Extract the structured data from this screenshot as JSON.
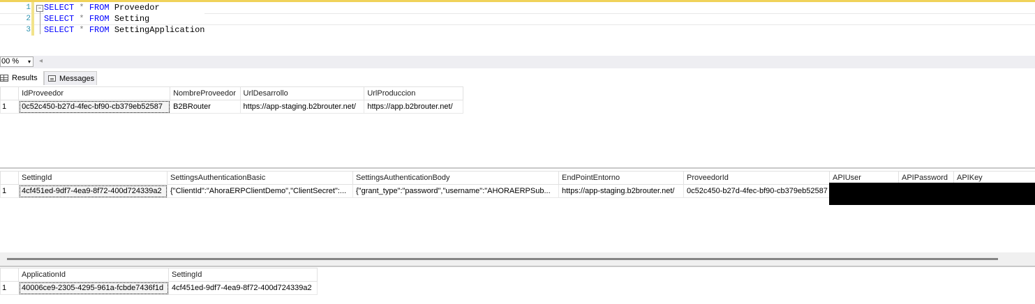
{
  "editor": {
    "line_numbers": [
      "1",
      "2",
      "3"
    ],
    "lines": [
      {
        "kw1": "SELECT",
        "op": "*",
        "kw2": "FROM",
        "table": "Proveedor"
      },
      {
        "kw1": "SELECT",
        "op": "*",
        "kw2": "FROM",
        "table": "Setting"
      },
      {
        "kw1": "SELECT",
        "op": "*",
        "kw2": "FROM",
        "table": "SettingApplication"
      }
    ],
    "fold_glyph": "−"
  },
  "zoom": {
    "value": "00 %",
    "arrow": "▾",
    "scroll_left": "◂"
  },
  "tabs": {
    "results": "Results",
    "messages": "Messages"
  },
  "grid1": {
    "columns": [
      "IdProveedor",
      "NombreProveedor",
      "UrlDesarrollo",
      "UrlProduccion"
    ],
    "rows": [
      {
        "rn": "1",
        "cells": [
          "0c52c450-b27d-4fec-bf90-cb379eb52587",
          "B2BRouter",
          "https://app-staging.b2brouter.net/",
          "https://app.b2brouter.net/"
        ]
      }
    ]
  },
  "grid2": {
    "columns": [
      "SettingId",
      "SettingsAuthenticationBasic",
      "SettingsAuthenticationBody",
      "EndPointEntorno",
      "ProveedorId",
      "APIUser",
      "APIPassword",
      "APIKey"
    ],
    "rows": [
      {
        "rn": "1",
        "cells": [
          "4cf451ed-9df7-4ea9-8f72-400d724339a2",
          "{\"ClientId\":\"AhoraERPClientDemo\",\"ClientSecret\":...",
          "{\"grant_type\":\"password\",\"username\":\"AHORAERPSub...",
          "https://app-staging.b2brouter.net/",
          "0c52c450-b27d-4fec-bf90-cb379eb52587",
          "",
          "",
          ""
        ]
      }
    ]
  },
  "grid3": {
    "columns": [
      "ApplicationId",
      "SettingId"
    ],
    "rows": [
      {
        "rn": "1",
        "cells": [
          "40006ce9-2305-4295-961a-fcbde7436f1d",
          "4cf451ed-9df7-4ea9-8f72-400d724339a2"
        ]
      }
    ]
  },
  "colors": {
    "keyword": "#0000ff",
    "line_number": "#2b91af",
    "redaction": "#000000"
  }
}
